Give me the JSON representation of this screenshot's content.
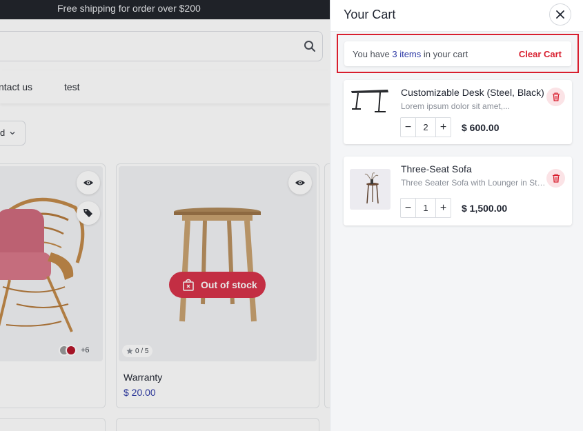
{
  "promo": {
    "text": "Free shipping for order over $200"
  },
  "nav": {
    "links": [
      "ntact us",
      "test"
    ]
  },
  "sort": {
    "value": "d"
  },
  "products": {
    "card2": {
      "badge": "Out of stock",
      "rating": "0 / 5",
      "title": "Warranty",
      "price": "$ 20.00"
    },
    "card1": {
      "swatches": [
        "#9b9b9b",
        "#b5162a"
      ],
      "more": "+6"
    }
  },
  "cart": {
    "title": "Your Cart",
    "summary_prefix": "You have ",
    "item_count": "3 items",
    "summary_suffix": " in your cart",
    "clear_label": "Clear Cart",
    "items": [
      {
        "name": "Customizable Desk (Steel, Black)",
        "desc": "Lorem ipsum dolor sit amet,...",
        "qty": "2",
        "price": "$ 600.00"
      },
      {
        "name": "Three-Seat Sofa",
        "desc": "Three Seater Sofa with Lounger in Ste...",
        "qty": "1",
        "price": "$ 1,500.00"
      }
    ]
  },
  "colors": {
    "accent": "#d81e2e",
    "link": "#2e3aa6",
    "oos": "#d7334a",
    "topbar": "#23262c"
  }
}
